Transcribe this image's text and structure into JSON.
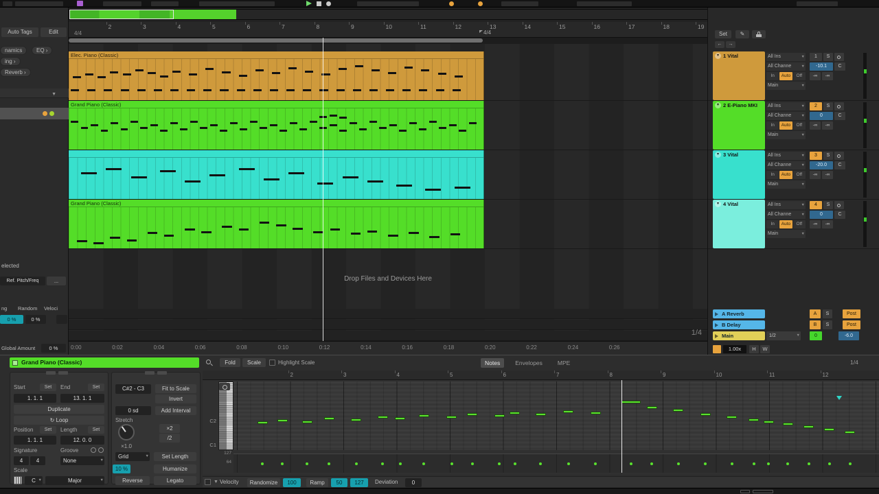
{
  "colors": {
    "clip_orange": "#cf9a3c",
    "clip_green": "#54dd28",
    "clip_cyan": "#38e0cd",
    "clip_cyan_light": "#7beedd",
    "return_blue": "#55b6e8",
    "main_yellow": "#e2d058",
    "value_blue": "#31688f",
    "value_teal": "#17a0ae",
    "active_orange": "#e8a33d",
    "note_green": "#5ae12e"
  },
  "sidebar": {
    "auto_tags": "Auto Tags",
    "edit": "Edit",
    "chips": [
      "namics",
      "EQ ›",
      "ing ›",
      "Reverb ›"
    ],
    "selected": "elected",
    "ref_pitch": "Ref. Pitch/Freq",
    "dots": "...",
    "cols": [
      "ng",
      "Random",
      "Veloci"
    ],
    "val1": "0 %",
    "val2": "0 %",
    "global_amount": "Global Amount",
    "global_amount_value": "0 %"
  },
  "arrangement": {
    "sig_left": "4/4",
    "sig_mid": "4/4",
    "bars_start": 2,
    "bars_end": 19,
    "drop_text": "Drop Files and Devices Here",
    "grid_label": "1/4",
    "time_labels": [
      "0:00",
      "0:02",
      "0:04",
      "0:06",
      "0:08",
      "0:10",
      "0:12",
      "0:14",
      "0:16",
      "0:18",
      "0:20",
      "0:22",
      "0:24",
      "0:26"
    ],
    "tracks": [
      {
        "clip_name": "Elec. Piano (Classic)",
        "color": "#cf9a3c",
        "note_w": 0.02,
        "notes": [
          [
            0.005,
            0.74
          ],
          [
            0.045,
            0.74
          ],
          [
            0.085,
            0.74
          ],
          [
            0.125,
            0.74
          ],
          [
            0.165,
            0.74
          ],
          [
            0.205,
            0.74
          ],
          [
            0.245,
            0.74
          ],
          [
            0.285,
            0.74
          ],
          [
            0.325,
            0.74
          ],
          [
            0.365,
            0.74
          ],
          [
            0.405,
            0.74
          ],
          [
            0.445,
            0.74
          ],
          [
            0.485,
            0.74
          ],
          [
            0.525,
            0.74
          ],
          [
            0.565,
            0.74
          ],
          [
            0.605,
            0.74
          ],
          [
            0.645,
            0.74
          ],
          [
            0.685,
            0.74
          ],
          [
            0.725,
            0.74
          ],
          [
            0.765,
            0.74
          ],
          [
            0.805,
            0.74
          ],
          [
            0.845,
            0.74
          ],
          [
            0.885,
            0.74
          ],
          [
            0.925,
            0.74
          ],
          [
            0.01,
            0.42
          ],
          [
            0.04,
            0.35
          ],
          [
            0.07,
            0.42
          ],
          [
            0.1,
            0.3
          ],
          [
            0.13,
            0.35
          ],
          [
            0.16,
            0.25
          ],
          [
            0.19,
            0.32
          ],
          [
            0.22,
            0.4
          ],
          [
            0.25,
            0.28
          ],
          [
            0.29,
            0.35
          ],
          [
            0.33,
            0.22
          ],
          [
            0.37,
            0.3
          ],
          [
            0.41,
            0.38
          ],
          [
            0.45,
            0.25
          ],
          [
            0.49,
            0.32
          ],
          [
            0.53,
            0.2
          ],
          [
            0.57,
            0.28
          ],
          [
            0.61,
            0.35
          ],
          [
            0.65,
            0.22
          ],
          [
            0.69,
            0.15
          ],
          [
            0.73,
            0.25
          ],
          [
            0.77,
            0.32
          ],
          [
            0.81,
            0.18
          ],
          [
            0.85,
            0.25
          ],
          [
            0.89,
            0.33
          ],
          [
            0.93,
            0.4
          ]
        ]
      },
      {
        "clip_name": "Grand Piano (Classic)",
        "color": "#54dd28",
        "note_w": 0.018,
        "notes": [
          [
            0.005,
            0.3
          ],
          [
            0.029,
            0.45
          ],
          [
            0.053,
            0.38
          ],
          [
            0.077,
            0.52
          ],
          [
            0.101,
            0.33
          ],
          [
            0.125,
            0.48
          ],
          [
            0.149,
            0.3
          ],
          [
            0.173,
            0.45
          ],
          [
            0.197,
            0.38
          ],
          [
            0.221,
            0.52
          ],
          [
            0.245,
            0.33
          ],
          [
            0.269,
            0.48
          ],
          [
            0.293,
            0.3
          ],
          [
            0.317,
            0.45
          ],
          [
            0.341,
            0.38
          ],
          [
            0.365,
            0.52
          ],
          [
            0.389,
            0.33
          ],
          [
            0.413,
            0.48
          ],
          [
            0.437,
            0.3
          ],
          [
            0.461,
            0.45
          ],
          [
            0.485,
            0.38
          ],
          [
            0.509,
            0.52
          ],
          [
            0.533,
            0.33
          ],
          [
            0.557,
            0.48
          ],
          [
            0.581,
            0.3
          ],
          [
            0.605,
            0.45
          ],
          [
            0.629,
            0.38
          ],
          [
            0.653,
            0.52
          ],
          [
            0.677,
            0.33
          ],
          [
            0.701,
            0.48
          ],
          [
            0.725,
            0.3
          ],
          [
            0.749,
            0.45
          ],
          [
            0.773,
            0.38
          ],
          [
            0.797,
            0.52
          ],
          [
            0.821,
            0.33
          ],
          [
            0.845,
            0.48
          ],
          [
            0.869,
            0.3
          ],
          [
            0.893,
            0.45
          ],
          [
            0.917,
            0.38
          ],
          [
            0.941,
            0.52
          ],
          [
            0.965,
            0.33
          ],
          [
            0.605,
            0.18
          ],
          [
            0.629,
            0.15
          ],
          [
            0.653,
            0.2
          ]
        ]
      },
      {
        "clip_name": "",
        "color": "#38e0cd",
        "note_w": 0.038,
        "notes": [
          [
            0.03,
            0.35
          ],
          [
            0.09,
            0.25
          ],
          [
            0.15,
            0.45
          ],
          [
            0.22,
            0.3
          ],
          [
            0.28,
            0.55
          ],
          [
            0.34,
            0.4
          ],
          [
            0.41,
            0.25
          ],
          [
            0.47,
            0.5
          ],
          [
            0.53,
            0.35
          ],
          [
            0.6,
            0.6
          ],
          [
            0.66,
            0.45
          ],
          [
            0.72,
            0.55
          ],
          [
            0.79,
            0.65
          ],
          [
            0.86,
            0.75
          ],
          [
            0.93,
            0.7
          ]
        ]
      },
      {
        "clip_name": "Grand Piano (Classic)",
        "color": "#54dd28",
        "note_w": 0.024,
        "notes": [
          [
            0.02,
            0.8
          ],
          [
            0.06,
            0.85
          ],
          [
            0.1,
            0.72
          ],
          [
            0.14,
            0.78
          ],
          [
            0.19,
            0.6
          ],
          [
            0.23,
            0.66
          ],
          [
            0.28,
            0.52
          ],
          [
            0.32,
            0.58
          ],
          [
            0.37,
            0.45
          ],
          [
            0.41,
            0.52
          ],
          [
            0.46,
            0.35
          ],
          [
            0.5,
            0.42
          ],
          [
            0.54,
            0.5
          ],
          [
            0.59,
            0.58
          ],
          [
            0.63,
            0.52
          ],
          [
            0.68,
            0.62
          ],
          [
            0.72,
            0.56
          ],
          [
            0.77,
            0.66
          ],
          [
            0.82,
            0.6
          ],
          [
            0.87,
            0.7
          ],
          [
            0.92,
            0.64
          ]
        ]
      }
    ]
  },
  "mixer": {
    "set_label": "Set",
    "tracks": [
      {
        "name": "1 Vital",
        "color": "#cf9a3c",
        "num": "1",
        "num_active": false,
        "in1": "All Ins",
        "in2": "All Channe",
        "monitor": [
          "In",
          "Auto",
          "Off"
        ],
        "out": "Main",
        "vol": "-10.1",
        "pan": "C",
        "sends": [
          "-∞",
          "-∞"
        ]
      },
      {
        "name": "2 E-Piano MKI",
        "color": "#54dd28",
        "num": "2",
        "num_active": true,
        "in1": "All Ins",
        "in2": "All Channe",
        "monitor": [
          "In",
          "Auto",
          "Off"
        ],
        "out": "Main",
        "vol": "0",
        "pan": "C",
        "sends": [
          "-∞",
          "-∞"
        ]
      },
      {
        "name": "3 Vital",
        "color": "#38e0cd",
        "num": "3",
        "num_active": true,
        "in1": "All Ins",
        "in2": "All Channe",
        "monitor": [
          "In",
          "Auto",
          "Off"
        ],
        "out": "Main",
        "vol": "-20.0",
        "pan": "C",
        "sends": [
          "-∞",
          "-∞"
        ]
      },
      {
        "name": "4 Vital",
        "color": "#7beedd",
        "num": "4",
        "num_active": true,
        "in1": "All Ins",
        "in2": "All Channe",
        "monitor": [
          "In",
          "Auto",
          "Off"
        ],
        "out": "Main",
        "vol": "0",
        "pan": "C",
        "sends": [
          "-∞",
          "-∞"
        ]
      }
    ],
    "returns": [
      {
        "name": "A Reverb",
        "color": "#55b6e8",
        "tag": "A",
        "solo": "S",
        "post": "Post"
      },
      {
        "name": "B Delay",
        "color": "#55b6e8",
        "tag": "B",
        "solo": "S",
        "post": "Post"
      }
    ],
    "main": {
      "name": "Main",
      "color": "#e2d058",
      "grid": "1/2",
      "cue": "0",
      "vol": "-6.0"
    },
    "zoom": {
      "speed": "1.00x",
      "h": "H",
      "w": "W"
    }
  },
  "clip": {
    "title": "Grand Piano (Classic)",
    "fold": "Fold",
    "scale_btn": "Scale",
    "highlight_scale": "Highlight Scale",
    "tabs": [
      "Notes",
      "Envelopes",
      "MPE"
    ],
    "grid_label": "1/4",
    "left": {
      "start": "Start",
      "set": "Set",
      "end": "End",
      "start_val": "1. 1. 1",
      "end_val": "13. 1. 1",
      "duplicate": "Duplicate",
      "loop": "Loop",
      "position": "Position",
      "length": "Length",
      "pos_val": "1. 1. 1",
      "len_val": "12. 0. 0",
      "signature": "Signature",
      "groove": "Groove",
      "sig_n": "4",
      "sig_d": "4",
      "groove_val": "None",
      "scale": "Scale",
      "root": "C",
      "mode": "Major"
    },
    "mid": {
      "range": "C#2 - C3",
      "fit": "Fit to Scale",
      "invert": "Invert",
      "sd": "0 sd",
      "add_interval": "Add Interval",
      "stretch": "Stretch",
      "stretch_val": "×1.0",
      "x2": "×2",
      "half": "/2",
      "grid": "Grid",
      "set_length": "Set Length",
      "humanize_pct": "10 %",
      "humanize": "Humanize",
      "reverse": "Reverse",
      "legato": "Legato"
    },
    "roll": {
      "bars": [
        "2",
        "3",
        "4",
        "5",
        "6",
        "7",
        "8",
        "9",
        "10",
        "11",
        "12"
      ],
      "c2": "C2",
      "c1": "C1",
      "vel_hi": "127",
      "vel_mid": "64",
      "notes": [
        [
          0.037,
          58,
          0.016
        ],
        [
          0.068,
          55,
          0.016
        ],
        [
          0.106,
          57,
          0.016
        ],
        [
          0.14,
          52,
          0.016
        ],
        [
          0.182,
          54,
          0.016
        ],
        [
          0.223,
          50,
          0.016
        ],
        [
          0.25,
          52,
          0.016
        ],
        [
          0.287,
          48,
          0.016
        ],
        [
          0.33,
          50,
          0.016
        ],
        [
          0.362,
          46,
          0.016
        ],
        [
          0.404,
          48,
          0.016
        ],
        [
          0.428,
          44,
          0.016
        ],
        [
          0.468,
          46,
          0.016
        ],
        [
          0.511,
          42,
          0.016
        ],
        [
          0.553,
          44,
          0.016
        ],
        [
          0.601,
          28,
          0.03
        ],
        [
          0.64,
          36,
          0.016
        ],
        [
          0.681,
          40,
          0.016
        ],
        [
          0.723,
          46,
          0.016
        ],
        [
          0.764,
          50,
          0.016
        ],
        [
          0.798,
          54,
          0.016
        ],
        [
          0.821,
          57,
          0.016
        ],
        [
          0.851,
          60,
          0.016
        ],
        [
          0.883,
          64,
          0.016
        ],
        [
          0.915,
          68,
          0.016
        ],
        [
          0.947,
          72,
          0.016
        ]
      ]
    },
    "velbar": {
      "mode": "Velocity",
      "randomize": "Randomize",
      "rand_val": "100",
      "ramp": "Ramp",
      "ramp_a": "50",
      "ramp_b": "127",
      "deviation": "Deviation",
      "dev_val": "0"
    }
  }
}
